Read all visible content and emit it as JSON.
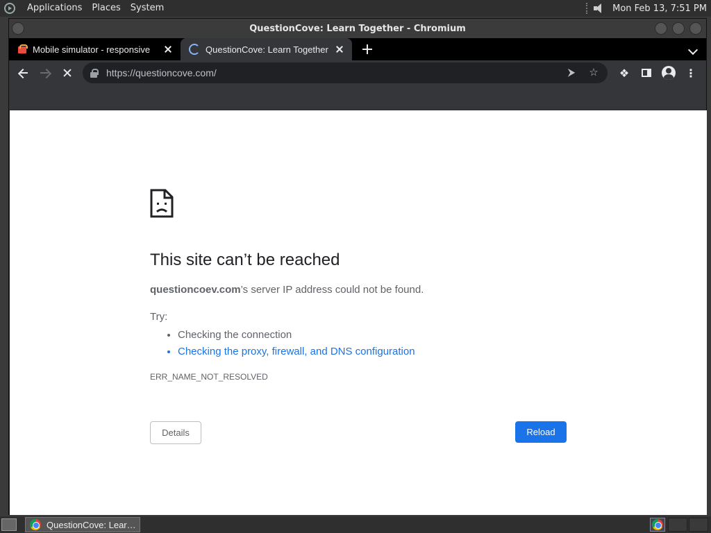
{
  "top_panel": {
    "menus": [
      "Applications",
      "Places",
      "System"
    ],
    "clock": "Mon Feb 13,  7:51 PM"
  },
  "window": {
    "title": "QuestionCove: Learn Together - Chromium"
  },
  "tabs": [
    {
      "title": "Mobile simulator - responsive",
      "icon": "mobile-simulator-favicon"
    },
    {
      "title": "QuestionCove: Learn Together",
      "icon": "loading-spinner",
      "active": true
    }
  ],
  "toolbar": {
    "url": "https://questioncove.com/"
  },
  "error_page": {
    "title": "This site can’t be reached",
    "host": "questioncoev.com",
    "desc_suffix": "’s server IP address could not be found.",
    "try_label": "Try:",
    "suggestions": [
      "Checking the connection",
      "Checking the proxy, firewall, and DNS configuration"
    ],
    "error_code": "ERR_NAME_NOT_RESOLVED",
    "details_label": "Details",
    "reload_label": "Reload",
    "link_color": "#1a73e8"
  },
  "taskbar": {
    "task_label": "QuestionCove: Lear…"
  }
}
